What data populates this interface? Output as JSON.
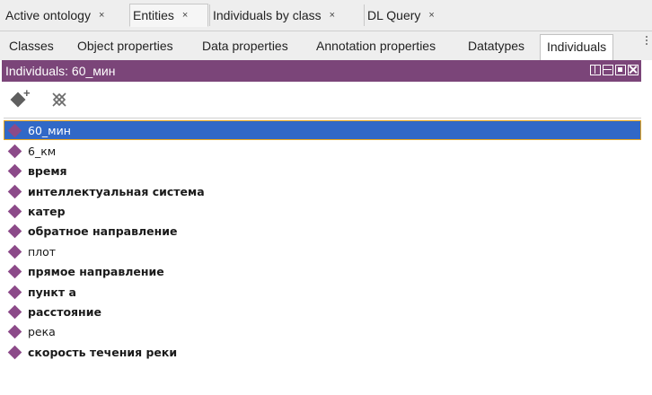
{
  "tabs": [
    {
      "label": "Active ontology",
      "close": "×"
    },
    {
      "label": "Entities",
      "close": "×"
    },
    {
      "label": "Individuals by class",
      "close": "×"
    },
    {
      "label": "DL Query",
      "close": "×"
    }
  ],
  "subtabs": [
    "Classes",
    "Object properties",
    "Data properties",
    "Annotation properties",
    "Datatypes",
    "Individuals"
  ],
  "view": {
    "title": "Individuals: 60_мин"
  },
  "toolbar": {
    "add_icon": "add-individual-icon",
    "delete_icon": "delete-individual-icon"
  },
  "individuals": [
    {
      "label": "60_мин",
      "bold": false,
      "selected": true
    },
    {
      "label": "6_км",
      "bold": false,
      "selected": false
    },
    {
      "label": "время",
      "bold": true,
      "selected": false
    },
    {
      "label": "интеллектуальная система",
      "bold": true,
      "selected": false
    },
    {
      "label": "катер",
      "bold": true,
      "selected": false
    },
    {
      "label": "обратное направление",
      "bold": true,
      "selected": false
    },
    {
      "label": "плот",
      "bold": false,
      "selected": false
    },
    {
      "label": "прямое направление",
      "bold": true,
      "selected": false
    },
    {
      "label": "пункт а",
      "bold": true,
      "selected": false
    },
    {
      "label": "расстояние",
      "bold": true,
      "selected": false
    },
    {
      "label": "река",
      "bold": false,
      "selected": false
    },
    {
      "label": "скорость течения реки",
      "bold": true,
      "selected": false
    }
  ],
  "colors": {
    "accent": "#7b4579",
    "selection": "#3168c7",
    "individual_icon": "#8c4a89"
  }
}
